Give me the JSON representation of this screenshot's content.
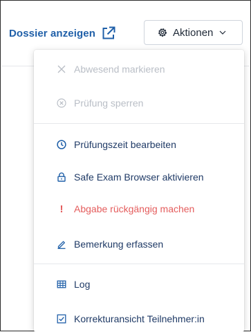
{
  "header": {
    "dossier_label": "Dossier anzeigen",
    "actions_label": "Aktionen"
  },
  "colors": {
    "link": "#1f5fa8",
    "disabled": "#b9bec6",
    "danger": "#e45c5c",
    "menu_text": "#1f3a66"
  },
  "menu": {
    "items": [
      {
        "label": "Abwesend markieren",
        "icon": "x-icon",
        "state": "disabled"
      },
      {
        "label": "Prüfung sperren",
        "icon": "x-circle-icon",
        "state": "disabled"
      },
      {
        "label": "Prüfungszeit bearbeiten",
        "icon": "clock-icon",
        "state": "enabled"
      },
      {
        "label": "Safe Exam Browser aktivieren",
        "icon": "lock-icon",
        "state": "enabled"
      },
      {
        "label": "Abgabe rückgängig machen",
        "icon": "exclamation-icon",
        "state": "danger"
      },
      {
        "label": "Bemerkung erfassen",
        "icon": "pencil-icon",
        "state": "enabled"
      },
      {
        "label": "Log",
        "icon": "table-icon",
        "state": "enabled"
      },
      {
        "label": "Korrekturansicht Teilnehmer:in",
        "icon": "checkbox-icon",
        "state": "enabled"
      }
    ]
  }
}
